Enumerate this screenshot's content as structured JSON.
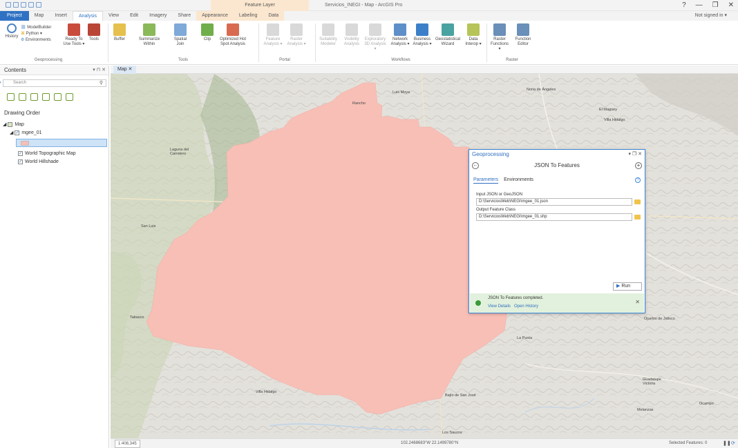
{
  "window": {
    "contextual_header": "Feature Layer",
    "app_title": "Servicios_INEGI - Map - ArcGIS Pro",
    "help": "?",
    "minimize": "—",
    "restore": "❐",
    "close": "✕",
    "signin": "Not signed in ▾"
  },
  "tabs": [
    "Project",
    "Map",
    "Insert",
    "Analysis",
    "View",
    "Edit",
    "Imagery",
    "Share",
    "Appearance",
    "Labeling",
    "Data"
  ],
  "ribbon": {
    "history": "History",
    "modelbuilder": "ModelBuilder",
    "python": "Python ▾",
    "environments": "Environments",
    "ready_to_use": "Ready To Use Tools ▾",
    "tools_btn": "Tools",
    "buffer": "Buffer",
    "summarize_within": "Summarize Within",
    "spatial_join": "Spatial Join",
    "clip": "Clip",
    "optimized_hot_spot": "Optimized Hot Spot Analysis",
    "feature_analysis": "Feature Analysis ▾",
    "raster_analysis": "Raster Analysis ▾",
    "suitability_modeler": "Suitability Modeler",
    "visibility_analysis": "Visibility Analysis",
    "exploratory_3d": "Exploratory 3D Analysis ▾",
    "network_analysis": "Network Analysis ▾",
    "business_analysis": "Business Analysis ▾",
    "geostatistical_wizard": "Geostatistical Wizard",
    "data_interop": "Data Interop ▾",
    "raster_functions": "Raster Functions ▾",
    "function_editor": "Function Editor",
    "groups": {
      "geoprocessing": "Geoprocessing",
      "tools": "Tools",
      "portal": "Portal",
      "workflows": "Workflows",
      "raster": "Raster"
    }
  },
  "contents": {
    "title": "Contents",
    "controls": "▾ ⊓ ✕",
    "search_placeholder": "Search",
    "drawing_order": "Drawing Order",
    "layers": [
      "Map",
      "mgee_01",
      "World Topographic Map",
      "World Hillshade"
    ]
  },
  "map_tab": "Map ✕",
  "places": [
    "Luis Moya",
    "Noria de Ángeles",
    "El Maguey",
    "Villa Hidalgo",
    "Laguna del Carretero",
    "San Luis",
    "Tabasco",
    "Villa Hidalgo",
    "Bajío de San José",
    "Los Sauzos",
    "Ojuelos de Jalisco",
    "La Punta",
    "Guadalupe Victoria",
    "Ocampo",
    "Melanzas",
    "Rancho"
  ],
  "geoprocessing": {
    "title": "Geoprocessing",
    "controls": "▾ ❐ ✕",
    "tool": "JSON To Features",
    "tab_params": "Parameters",
    "tab_env": "Environments",
    "input_label": "Input JSON or GeoJSON",
    "input_value": "D:\\ServiciosWeb\\NEGI\\mgee_01.json",
    "output_label": "Output Feature Class",
    "output_value": "D:\\ServiciosWeb\\NEGI\\mgee_01.shp",
    "run": "Run",
    "completed": "JSON To Features completed.",
    "view_details": "View Details",
    "open_history": "Open History"
  },
  "status": {
    "scale": "1:408,345",
    "coords": "102.2468683°W 22.1499780°N",
    "selected": "Selected Features: 0"
  },
  "colors": {
    "accent": "#2f72c3",
    "polygon": "#f7bfb6",
    "completed_bg": "#e2f1dd"
  }
}
